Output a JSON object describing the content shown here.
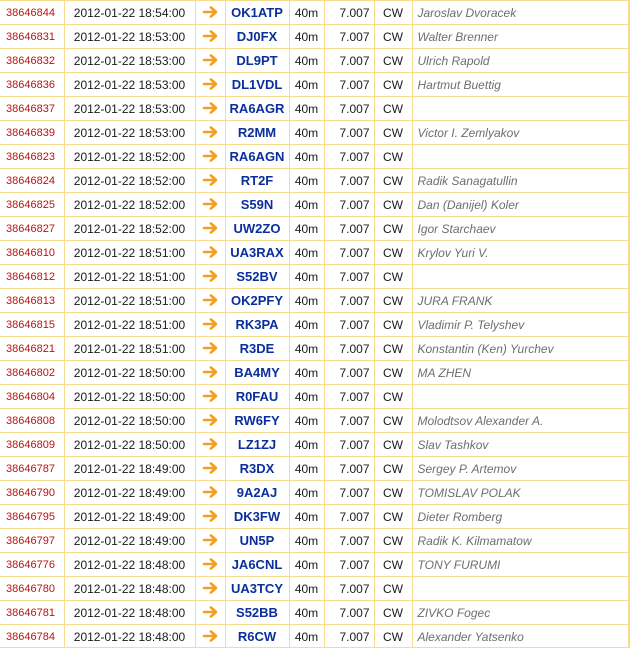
{
  "colors": {
    "id_text": "#c01010",
    "callsign_text": "#0a2f9c",
    "name_text": "#6e6e6e",
    "row_border": "#f6dd8e",
    "arrow": "#f2a11f"
  },
  "icons": {
    "direction": "right-arrow-icon"
  },
  "rows": [
    {
      "id": "38646844",
      "time": "2012-01-22 18:54:00",
      "call": "OK1ATP",
      "band": "40m",
      "freq": "7.007",
      "mode": "CW",
      "name": "Jaroslav Dvoracek"
    },
    {
      "id": "38646831",
      "time": "2012-01-22 18:53:00",
      "call": "DJ0FX",
      "band": "40m",
      "freq": "7.007",
      "mode": "CW",
      "name": "Walter Brenner"
    },
    {
      "id": "38646832",
      "time": "2012-01-22 18:53:00",
      "call": "DL9PT",
      "band": "40m",
      "freq": "7.007",
      "mode": "CW",
      "name": "Ulrich Rapold"
    },
    {
      "id": "38646836",
      "time": "2012-01-22 18:53:00",
      "call": "DL1VDL",
      "band": "40m",
      "freq": "7.007",
      "mode": "CW",
      "name": "Hartmut Buettig"
    },
    {
      "id": "38646837",
      "time": "2012-01-22 18:53:00",
      "call": "RA6AGR",
      "band": "40m",
      "freq": "7.007",
      "mode": "CW",
      "name": ""
    },
    {
      "id": "38646839",
      "time": "2012-01-22 18:53:00",
      "call": "R2MM",
      "band": "40m",
      "freq": "7.007",
      "mode": "CW",
      "name": "Victor I. Zemlyakov"
    },
    {
      "id": "38646823",
      "time": "2012-01-22 18:52:00",
      "call": "RA6AGN",
      "band": "40m",
      "freq": "7.007",
      "mode": "CW",
      "name": ""
    },
    {
      "id": "38646824",
      "time": "2012-01-22 18:52:00",
      "call": "RT2F",
      "band": "40m",
      "freq": "7.007",
      "mode": "CW",
      "name": "Radik Sanagatullin"
    },
    {
      "id": "38646825",
      "time": "2012-01-22 18:52:00",
      "call": "S59N",
      "band": "40m",
      "freq": "7.007",
      "mode": "CW",
      "name": "Dan (Danijel) Koler"
    },
    {
      "id": "38646827",
      "time": "2012-01-22 18:52:00",
      "call": "UW2ZO",
      "band": "40m",
      "freq": "7.007",
      "mode": "CW",
      "name": "Igor Starchaev"
    },
    {
      "id": "38646810",
      "time": "2012-01-22 18:51:00",
      "call": "UA3RAX",
      "band": "40m",
      "freq": "7.007",
      "mode": "CW",
      "name": "Krylov Yuri V."
    },
    {
      "id": "38646812",
      "time": "2012-01-22 18:51:00",
      "call": "S52BV",
      "band": "40m",
      "freq": "7.007",
      "mode": "CW",
      "name": ""
    },
    {
      "id": "38646813",
      "time": "2012-01-22 18:51:00",
      "call": "OK2PFY",
      "band": "40m",
      "freq": "7.007",
      "mode": "CW",
      "name": "JURA FRANK"
    },
    {
      "id": "38646815",
      "time": "2012-01-22 18:51:00",
      "call": "RK3PA",
      "band": "40m",
      "freq": "7.007",
      "mode": "CW",
      "name": "Vladimir P. Telyshev"
    },
    {
      "id": "38646821",
      "time": "2012-01-22 18:51:00",
      "call": "R3DE",
      "band": "40m",
      "freq": "7.007",
      "mode": "CW",
      "name": "Konstantin (Ken) Yurchev"
    },
    {
      "id": "38646802",
      "time": "2012-01-22 18:50:00",
      "call": "BA4MY",
      "band": "40m",
      "freq": "7.007",
      "mode": "CW",
      "name": "MA ZHEN"
    },
    {
      "id": "38646804",
      "time": "2012-01-22 18:50:00",
      "call": "R0FAU",
      "band": "40m",
      "freq": "7.007",
      "mode": "CW",
      "name": ""
    },
    {
      "id": "38646808",
      "time": "2012-01-22 18:50:00",
      "call": "RW6FY",
      "band": "40m",
      "freq": "7.007",
      "mode": "CW",
      "name": "Molodtsov Alexander A."
    },
    {
      "id": "38646809",
      "time": "2012-01-22 18:50:00",
      "call": "LZ1ZJ",
      "band": "40m",
      "freq": "7.007",
      "mode": "CW",
      "name": "Slav Tashkov"
    },
    {
      "id": "38646787",
      "time": "2012-01-22 18:49:00",
      "call": "R3DX",
      "band": "40m",
      "freq": "7.007",
      "mode": "CW",
      "name": "Sergey P. Artemov"
    },
    {
      "id": "38646790",
      "time": "2012-01-22 18:49:00",
      "call": "9A2AJ",
      "band": "40m",
      "freq": "7.007",
      "mode": "CW",
      "name": "TOMISLAV POLAK"
    },
    {
      "id": "38646795",
      "time": "2012-01-22 18:49:00",
      "call": "DK3FW",
      "band": "40m",
      "freq": "7.007",
      "mode": "CW",
      "name": "Dieter Romberg"
    },
    {
      "id": "38646797",
      "time": "2012-01-22 18:49:00",
      "call": "UN5P",
      "band": "40m",
      "freq": "7.007",
      "mode": "CW",
      "name": "Radik K. Kilmamatow"
    },
    {
      "id": "38646776",
      "time": "2012-01-22 18:48:00",
      "call": "JA6CNL",
      "band": "40m",
      "freq": "7.007",
      "mode": "CW",
      "name": "TONY FURUMI"
    },
    {
      "id": "38646780",
      "time": "2012-01-22 18:48:00",
      "call": "UA3TCY",
      "band": "40m",
      "freq": "7.007",
      "mode": "CW",
      "name": ""
    },
    {
      "id": "38646781",
      "time": "2012-01-22 18:48:00",
      "call": "S52BB",
      "band": "40m",
      "freq": "7.007",
      "mode": "CW",
      "name": "ZIVKO Fogec"
    },
    {
      "id": "38646784",
      "time": "2012-01-22 18:48:00",
      "call": "R6CW",
      "band": "40m",
      "freq": "7.007",
      "mode": "CW",
      "name": "Alexander Yatsenko"
    }
  ]
}
